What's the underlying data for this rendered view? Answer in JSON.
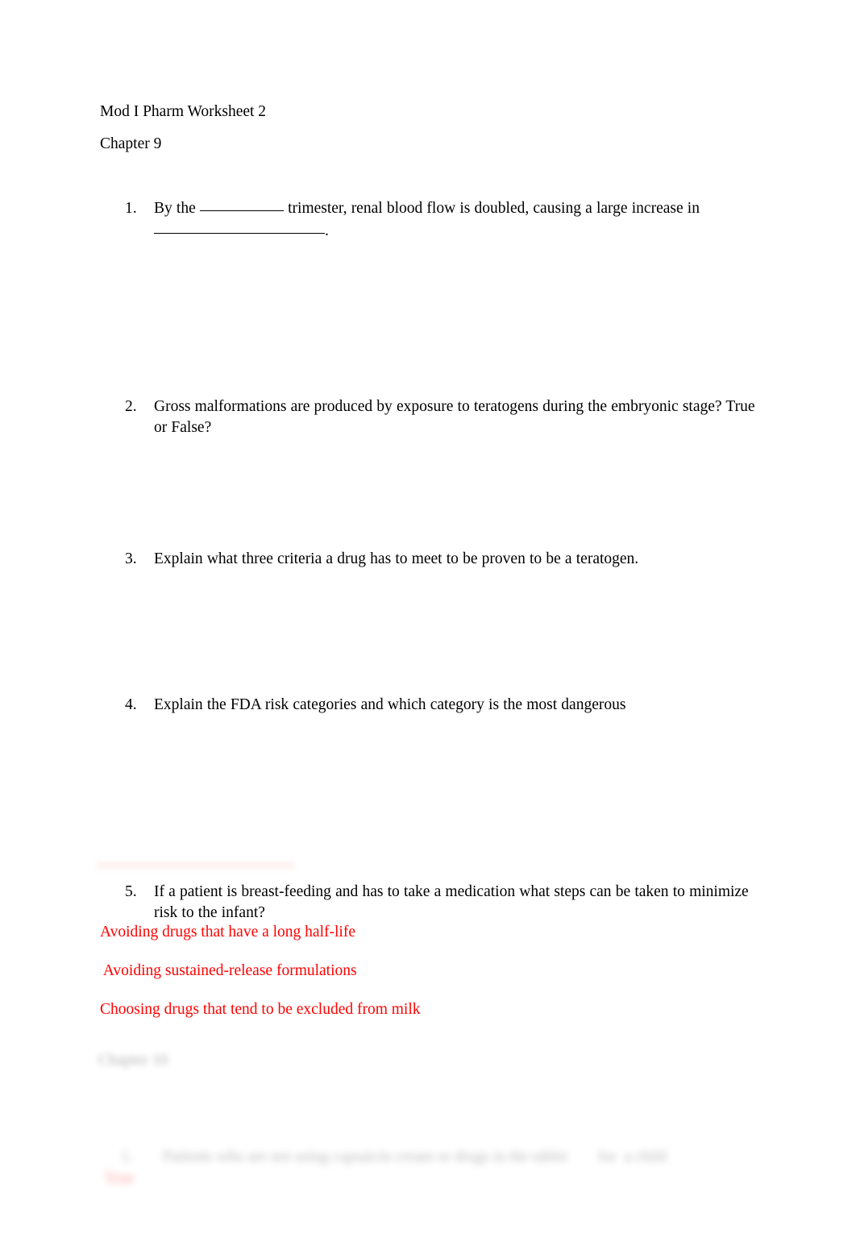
{
  "document": {
    "title": "Mod I Pharm Worksheet 2",
    "subtitle": "Chapter 9"
  },
  "questions": [
    {
      "number": "1.",
      "line1_before_blank": "By the ",
      "line1_after_blank": " trimester, renal blood flow is doubled, causing a large increase in",
      "line2_after_blank": "."
    },
    {
      "number": "2.",
      "text": "Gross malformations are produced by exposure to teratogens during the embryonic stage? True or False?"
    },
    {
      "number": "3.",
      "text": "Explain what three criteria a drug has to meet to be proven to be a teratogen."
    },
    {
      "number": "4.",
      "text": "Explain the FDA risk categories and which category is the most dangerous"
    },
    {
      "number": "5.",
      "text": "If a patient is breast-feeding and has to take a medication what steps can be taken to minimize risk to the infant?"
    }
  ],
  "answers": {
    "color": "#ff0000",
    "lines": [
      "Avoiding drugs that have a long half-life",
      " Avoiding sustained-release formulations",
      "Choosing drugs that tend to be excluded from milk"
    ]
  },
  "obscured": {
    "chapter_heading": "Chapter 10",
    "question_number": "1.",
    "question_text": "Patients who are not using capsaicin cream or drugs in the tablet",
    "question_trailing": "for  a child",
    "red_word": "True"
  }
}
